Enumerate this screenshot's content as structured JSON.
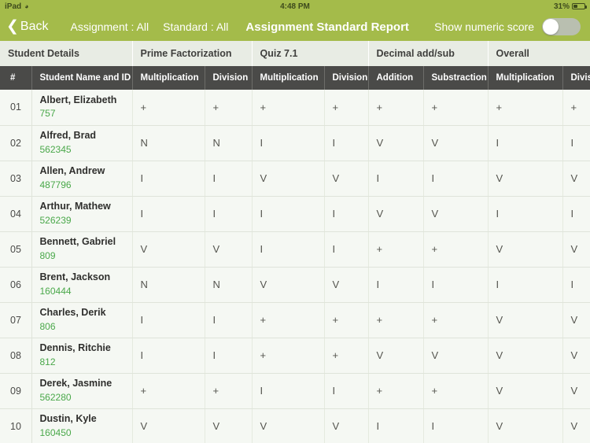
{
  "status_bar": {
    "device": "iPad",
    "wifi_icon": "wifi-icon",
    "time": "4:48 PM",
    "battery_percent": "31%",
    "battery_icon": "battery-icon"
  },
  "navbar": {
    "back_label": "Back",
    "back_icon": "chevron-left-icon",
    "assignment_filter": "Assignment : All",
    "standard_filter": "Standard : All",
    "title": "Assignment Standard Report",
    "toggle_label": "Show numeric score",
    "toggle_state": "off"
  },
  "colors": {
    "navbar": "#a4bb4a",
    "sub_header": "#4a4a48",
    "group_header": "#e8ece4",
    "row_background": "#f5f8f3",
    "student_id": "#4aa84a"
  },
  "table": {
    "group_headers": [
      {
        "label": "Student Details",
        "span": 2
      },
      {
        "label": "Prime Factorization",
        "span": 2
      },
      {
        "label": "Quiz 7.1",
        "span": 2
      },
      {
        "label": "Decimal add/sub",
        "span": 2
      },
      {
        "label": "Overall",
        "span": 2
      }
    ],
    "sub_headers": [
      "#",
      "Student Name and ID",
      "Multiplication",
      "Division",
      "Multiplication",
      "Division",
      "Addition",
      "Substraction",
      "Multiplication",
      "Division"
    ],
    "rows": [
      {
        "num": "01",
        "name": "Albert, Elizabeth",
        "id": "757",
        "marks": [
          "+",
          "+",
          "+",
          "+",
          "+",
          "+",
          "+",
          "+"
        ]
      },
      {
        "num": "02",
        "name": "Alfred, Brad",
        "id": "562345",
        "marks": [
          "N",
          "N",
          "I",
          "I",
          "V",
          "V",
          "I",
          "I"
        ]
      },
      {
        "num": "03",
        "name": "Allen, Andrew",
        "id": "487796",
        "marks": [
          "I",
          "I",
          "V",
          "V",
          "I",
          "I",
          "V",
          "V"
        ]
      },
      {
        "num": "04",
        "name": "Arthur, Mathew",
        "id": "526239",
        "marks": [
          "I",
          "I",
          "I",
          "I",
          "V",
          "V",
          "I",
          "I"
        ]
      },
      {
        "num": "05",
        "name": "Bennett, Gabriel",
        "id": "809",
        "marks": [
          "V",
          "V",
          "I",
          "I",
          "+",
          "+",
          "V",
          "V"
        ]
      },
      {
        "num": "06",
        "name": "Brent, Jackson",
        "id": "160444",
        "marks": [
          "N",
          "N",
          "V",
          "V",
          "I",
          "I",
          "I",
          "I"
        ]
      },
      {
        "num": "07",
        "name": "Charles, Derik",
        "id": "806",
        "marks": [
          "I",
          "I",
          "+",
          "+",
          "+",
          "+",
          "V",
          "V"
        ]
      },
      {
        "num": "08",
        "name": "Dennis, Ritchie",
        "id": "812",
        "marks": [
          "I",
          "I",
          "+",
          "+",
          "V",
          "V",
          "V",
          "V"
        ]
      },
      {
        "num": "09",
        "name": "Derek, Jasmine",
        "id": "562280",
        "marks": [
          "+",
          "+",
          "I",
          "I",
          "+",
          "+",
          "V",
          "V"
        ]
      },
      {
        "num": "10",
        "name": "Dustin, Kyle",
        "id": "160450",
        "marks": [
          "V",
          "V",
          "V",
          "V",
          "I",
          "I",
          "V",
          "V"
        ]
      }
    ]
  }
}
